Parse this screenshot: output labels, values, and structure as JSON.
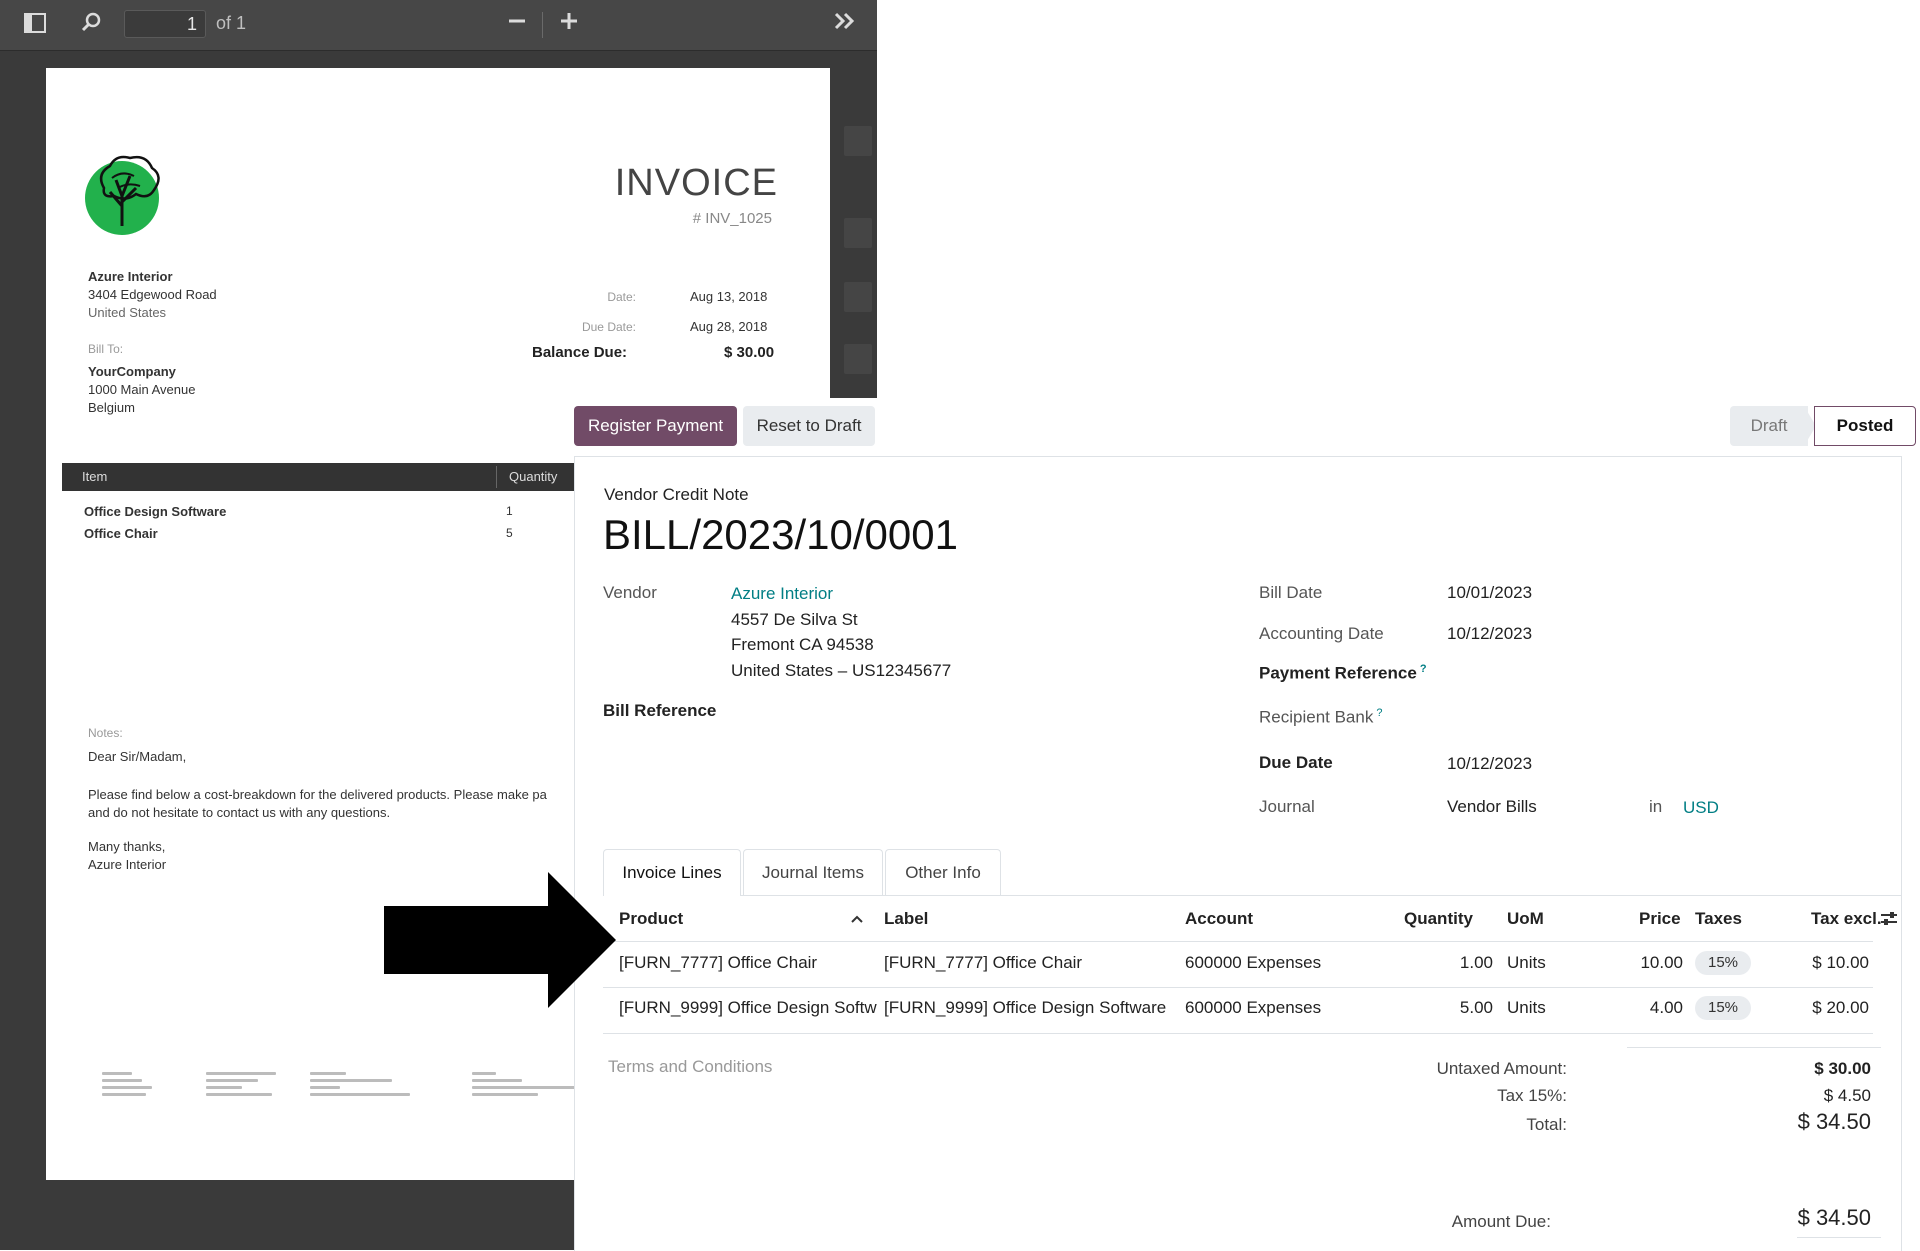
{
  "pdf_viewer": {
    "current_page": "1",
    "page_total": "of 1",
    "icons": [
      "sidebar-toggle-icon",
      "search-icon",
      "zoom-out-icon",
      "zoom-in-icon",
      "more-tools-icon"
    ],
    "document": {
      "title": "INVOICE",
      "number": "# INV_1025",
      "from": {
        "name": "Azure Interior",
        "line1": "3404 Edgewood Road",
        "line2": "United States"
      },
      "bill_to_label": "Bill To:",
      "bill_to": {
        "name": "YourCompany",
        "line1": "1000 Main Avenue",
        "line2": "Belgium"
      },
      "date_label": "Date:",
      "date": "Aug 13, 2018",
      "due_date_label": "Due Date:",
      "due_date": "Aug 28, 2018",
      "balance_due_label": "Balance Due:",
      "balance_due": "$ 30.00",
      "table_headers": [
        "Item",
        "Quantity"
      ],
      "items": [
        {
          "name": "Office Design Software",
          "qty": "1"
        },
        {
          "name": "Office Chair",
          "qty": "5"
        }
      ],
      "notes_label": "Notes:",
      "notes_greeting": "Dear Sir/Madam,",
      "notes_body_1": "Please find below a cost-breakdown for the delivered products. Please make pa",
      "notes_body_2": "and do not hesitate to contact us with any questions.",
      "notes_sign_1": "Many thanks,",
      "notes_sign_2": "Azure Interior"
    }
  },
  "form": {
    "buttons": {
      "register_payment": "Register Payment",
      "reset_to_draft": "Reset to Draft"
    },
    "status": {
      "draft": "Draft",
      "posted": "Posted"
    },
    "doc_type": "Vendor Credit Note",
    "doc_name": "BILL/2023/10/0001",
    "vendor_label": "Vendor",
    "vendor_name": "Azure Interior",
    "vendor_address_1": "4557 De Silva St",
    "vendor_address_2": "Fremont CA 94538",
    "vendor_address_3": "United States – US12345677",
    "bill_reference_label": "Bill Reference",
    "bill_date_label": "Bill Date",
    "bill_date": "10/01/2023",
    "accounting_date_label": "Accounting Date",
    "accounting_date": "10/12/2023",
    "payment_reference_label": "Payment Reference",
    "recipient_bank_label": "Recipient Bank",
    "help_mark": "?",
    "due_date_label": "Due Date",
    "due_date": "10/12/2023",
    "journal_label": "Journal",
    "journal": "Vendor Bills",
    "journal_in": "in",
    "currency": "USD",
    "tabs": [
      "Invoice Lines",
      "Journal Items",
      "Other Info"
    ],
    "columns": {
      "product": "Product",
      "label": "Label",
      "account": "Account",
      "quantity": "Quantity",
      "uom": "UoM",
      "price": "Price",
      "taxes": "Taxes",
      "tax_excl": "Tax excl."
    },
    "lines": [
      {
        "product": "[FURN_7777] Office Chair",
        "label": "[FURN_7777] Office Chair",
        "account": "600000 Expenses",
        "quantity": "1.00",
        "uom": "Units",
        "price": "10.00",
        "tax": "15%",
        "subtotal": "$ 10.00"
      },
      {
        "product": "[FURN_9999] Office Design Softw",
        "label": "[FURN_9999] Office Design Software",
        "account": "600000 Expenses",
        "quantity": "5.00",
        "uom": "Units",
        "price": "4.00",
        "tax": "15%",
        "subtotal": "$ 20.00"
      }
    ],
    "terms_placeholder": "Terms and Conditions",
    "totals": {
      "untaxed_label": "Untaxed Amount:",
      "untaxed": "$ 30.00",
      "tax_label": "Tax 15%:",
      "tax": "$ 4.50",
      "total_label": "Total:",
      "total": "$ 34.50",
      "amount_due_label": "Amount Due:",
      "amount_due": "$ 34.50"
    }
  },
  "colors": {
    "primary": "#714b67",
    "link": "#017e84",
    "annotation_arrow": "#000000"
  }
}
